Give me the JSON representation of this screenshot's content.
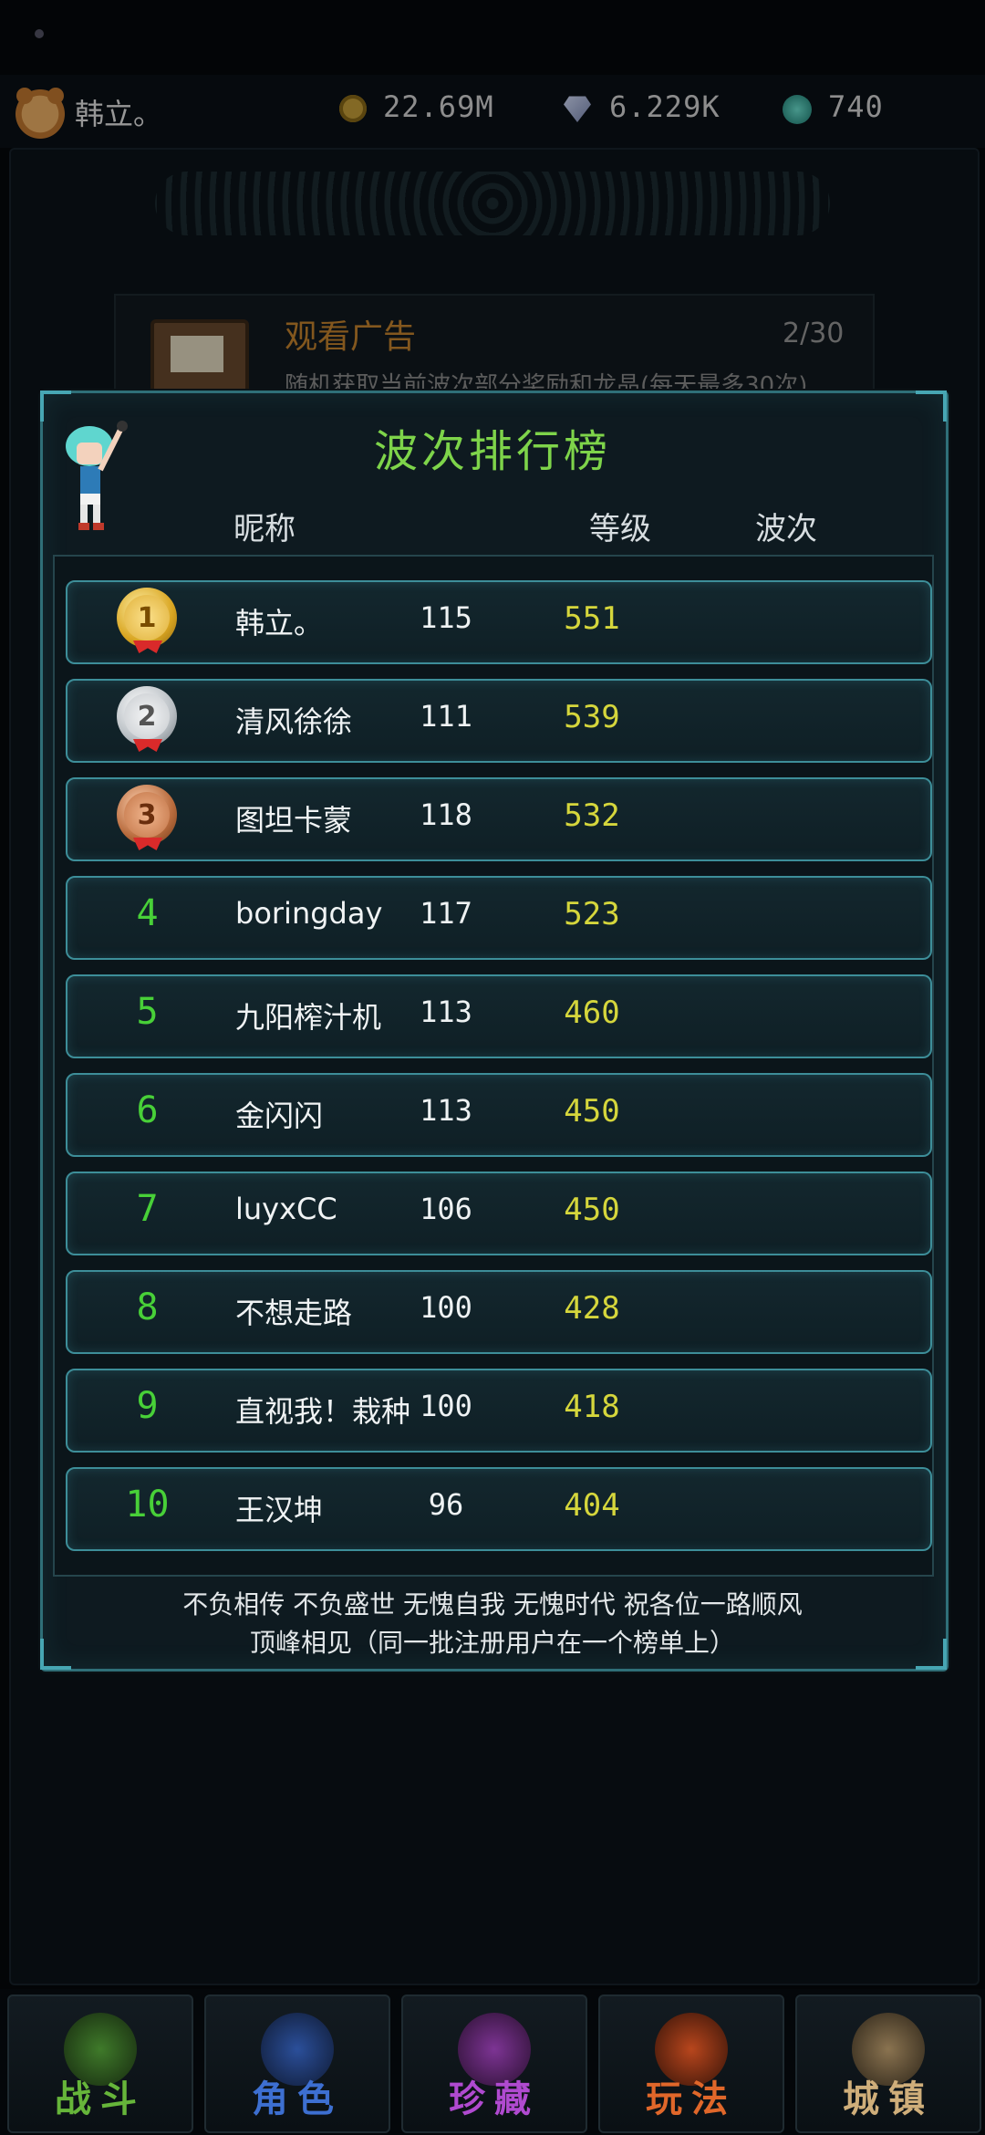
{
  "topbar": {
    "nickname": "韩立。",
    "gold": "22.69M",
    "diamond": "6.229K",
    "jade": "740"
  },
  "ad": {
    "title": "观看广告",
    "count": "2/30",
    "desc": "随机获取当前波次部分奖励和龙晶(每天最多30次)"
  },
  "leaderboard": {
    "title": "波次排行榜",
    "headers": {
      "name": "昵称",
      "level": "等级",
      "wave": "波次"
    },
    "rows": [
      {
        "rank": "1",
        "name": "韩立。",
        "level": "115",
        "wave": "551"
      },
      {
        "rank": "2",
        "name": "清风徐徐",
        "level": "111",
        "wave": "539"
      },
      {
        "rank": "3",
        "name": "图坦卡蒙",
        "level": "118",
        "wave": "532"
      },
      {
        "rank": "4",
        "name": "boringday",
        "level": "117",
        "wave": "523"
      },
      {
        "rank": "5",
        "name": "九阳榨汁机",
        "level": "113",
        "wave": "460"
      },
      {
        "rank": "6",
        "name": "金闪闪",
        "level": "113",
        "wave": "450"
      },
      {
        "rank": "7",
        "name": "luyxCC",
        "level": "106",
        "wave": "450"
      },
      {
        "rank": "8",
        "name": "不想走路",
        "level": "100",
        "wave": "428"
      },
      {
        "rank": "9",
        "name": "直视我！栽种",
        "level": "100",
        "wave": "418"
      },
      {
        "rank": "10",
        "name": "王汉坤",
        "level": "96",
        "wave": "404"
      }
    ],
    "footer_line1": "不负相传 不负盛世 无愧自我 无愧时代 祝各位一路顺风",
    "footer_line2": "顶峰相见（同一批注册用户在一个榜单上）"
  },
  "nav": [
    {
      "label": "战斗",
      "color": "#66b53a"
    },
    {
      "label": "角色",
      "color": "#3d6fd1"
    },
    {
      "label": "珍藏",
      "color": "#b04ad0"
    },
    {
      "label": "玩法",
      "color": "#e0672a"
    },
    {
      "label": "城镇",
      "color": "#cfae7a"
    }
  ]
}
